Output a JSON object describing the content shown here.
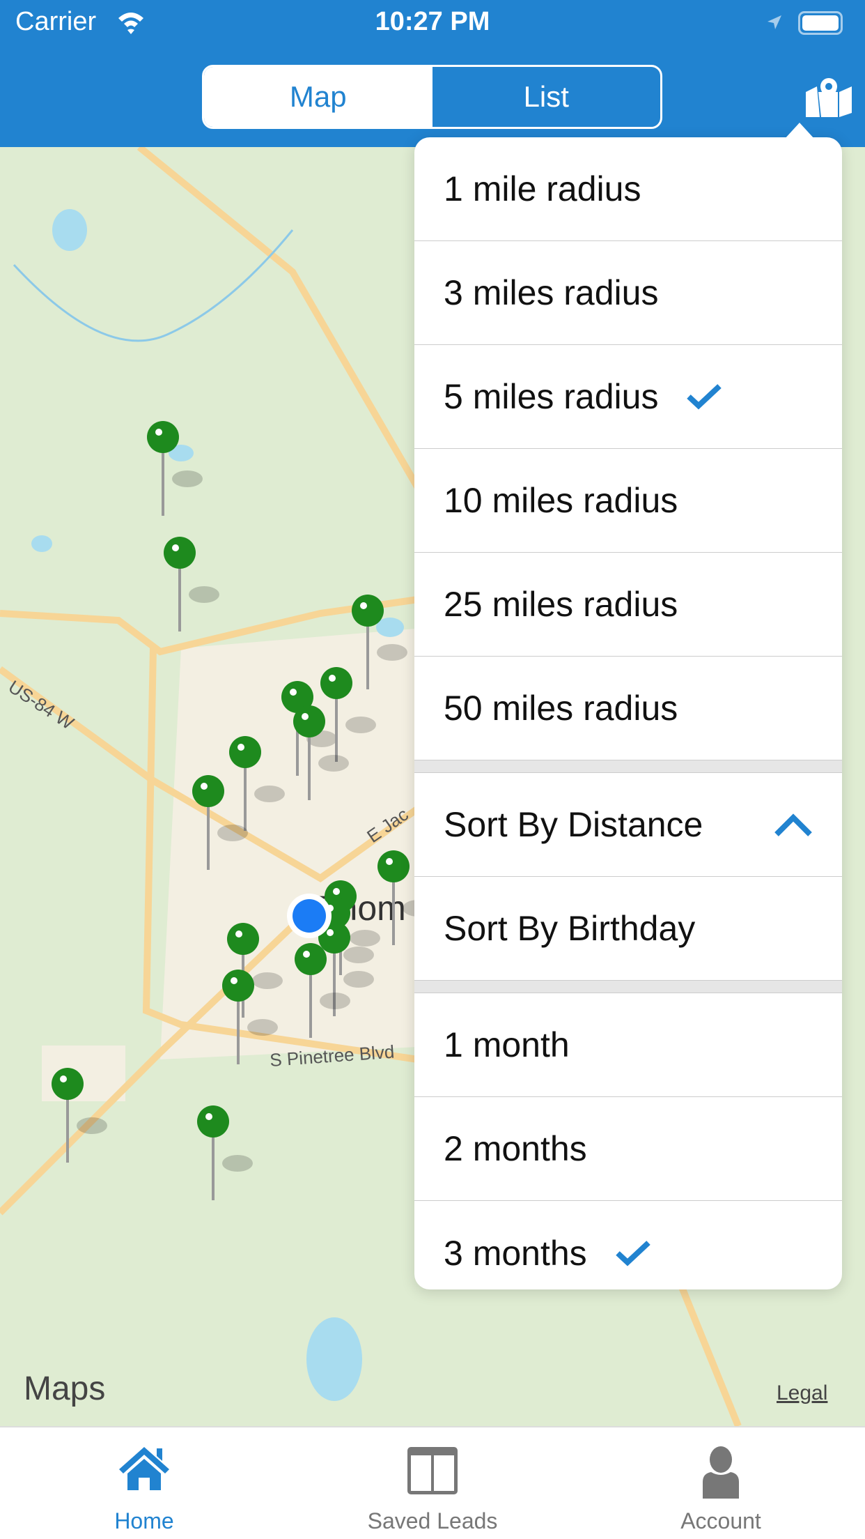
{
  "status_bar": {
    "carrier": "Carrier",
    "time": "10:27 PM"
  },
  "header": {
    "segments": [
      {
        "label": "Map",
        "selected": true
      },
      {
        "label": "List",
        "selected": false
      }
    ],
    "map_icon": "map-pin-icon"
  },
  "map": {
    "attribution": "Maps",
    "legal": "Legal",
    "labels": [
      "US-84 W",
      "E Jac",
      "Thom",
      "S Pinetree Blvd"
    ]
  },
  "dropdown": {
    "radius": [
      {
        "label": "1 mile radius",
        "checked": false
      },
      {
        "label": "3 miles radius",
        "checked": false
      },
      {
        "label": "5 miles radius",
        "checked": true
      },
      {
        "label": "10 miles radius",
        "checked": false
      },
      {
        "label": "25 miles radius",
        "checked": false
      },
      {
        "label": "50 miles radius",
        "checked": false
      }
    ],
    "sort": [
      {
        "label": "Sort By Distance",
        "indicator": "chevron-up"
      },
      {
        "label": "Sort By Birthday"
      }
    ],
    "months": [
      {
        "label": "1 month",
        "checked": false
      },
      {
        "label": "2 months",
        "checked": false
      },
      {
        "label": "3 months",
        "checked": true
      }
    ]
  },
  "tabbar": [
    {
      "label": "Home",
      "icon": "home-icon",
      "active": true
    },
    {
      "label": "Saved Leads",
      "icon": "columns-icon",
      "active": false
    },
    {
      "label": "Account",
      "icon": "person-icon",
      "active": false
    }
  ],
  "colors": {
    "brand": "#2183d0",
    "pin": "#1e8a1e",
    "map_bg": "#dfecd2"
  }
}
